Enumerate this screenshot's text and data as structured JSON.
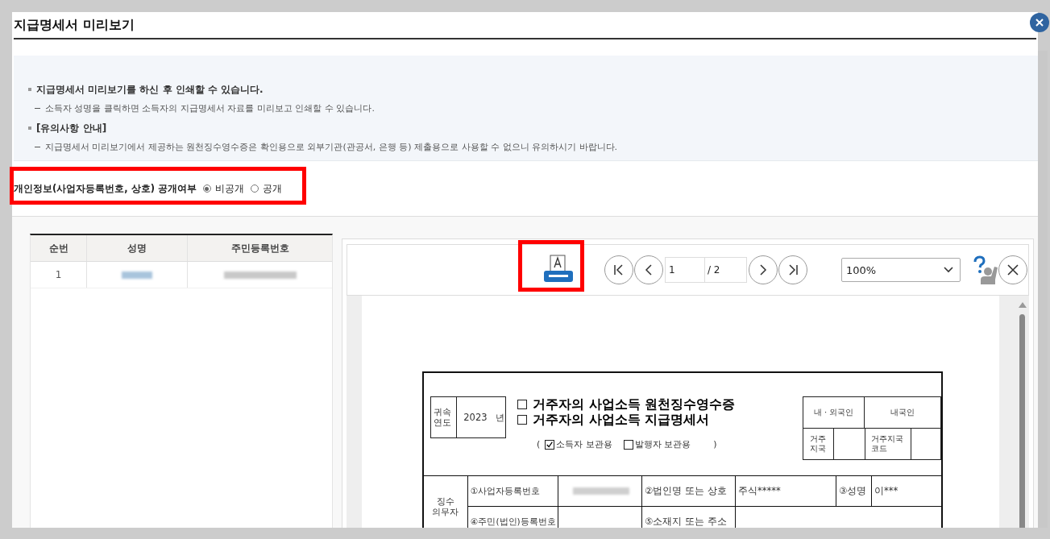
{
  "window": {
    "title": "지급명세서 미리보기"
  },
  "notices": [
    {
      "kind": "bullet",
      "text": "지급명세서 미리보기를 하신 후 인쇄할 수 있습니다."
    },
    {
      "kind": "dash",
      "text": "소득자 성명을 클릭하면 소득자의 지급명세서 자료를 미리보고 인쇄할 수 있습니다."
    },
    {
      "kind": "bullet",
      "text": "[유의사항 안내]"
    },
    {
      "kind": "dash",
      "text": "지급명세서 미리보기에서 제공하는 원천징수영수증은 확인용으로 외부기관(관공서, 은행 등) 제출용으로 사용할 수 없으니 유의하시기 바랍니다."
    }
  ],
  "privacy": {
    "label": "개인정보(사업자등록번호, 상호) 공개여부",
    "options": [
      {
        "label": "비공개",
        "selected": true
      },
      {
        "label": "공개",
        "selected": false
      }
    ]
  },
  "table": {
    "columns": [
      "순번",
      "성명",
      "주민등록번호"
    ],
    "rows": [
      {
        "no": "1"
      }
    ]
  },
  "viewer": {
    "page": "1",
    "total": "/ 2",
    "zoom": "100%"
  },
  "document": {
    "year_label": "귀속 연도",
    "year": "2023",
    "year_unit": "년",
    "titles": [
      {
        "label": "거주자의 사업소득 원천징수영수증",
        "checked": false
      },
      {
        "label": "거주자의 사업소득 지급명세서",
        "checked": false
      }
    ],
    "paren_open": "(",
    "paren_close": ")",
    "copies": [
      {
        "label": "소득자 보관용",
        "checked": true
      },
      {
        "label": "발행자 보관용",
        "checked": false
      }
    ],
    "nationality_label": "내 · 외국인",
    "nationality": "내국인",
    "residence_label": "거주 지국",
    "residence_code_label": "거주지국 코드",
    "section_label": "징수 의무자",
    "row1": [
      "①사업자등록번호",
      "②법인명 또는 상호",
      "주식*****",
      "③성명",
      "이***"
    ],
    "row2": [
      "④주민(법인)등록번호",
      "⑤소재지 또는 주소"
    ]
  }
}
